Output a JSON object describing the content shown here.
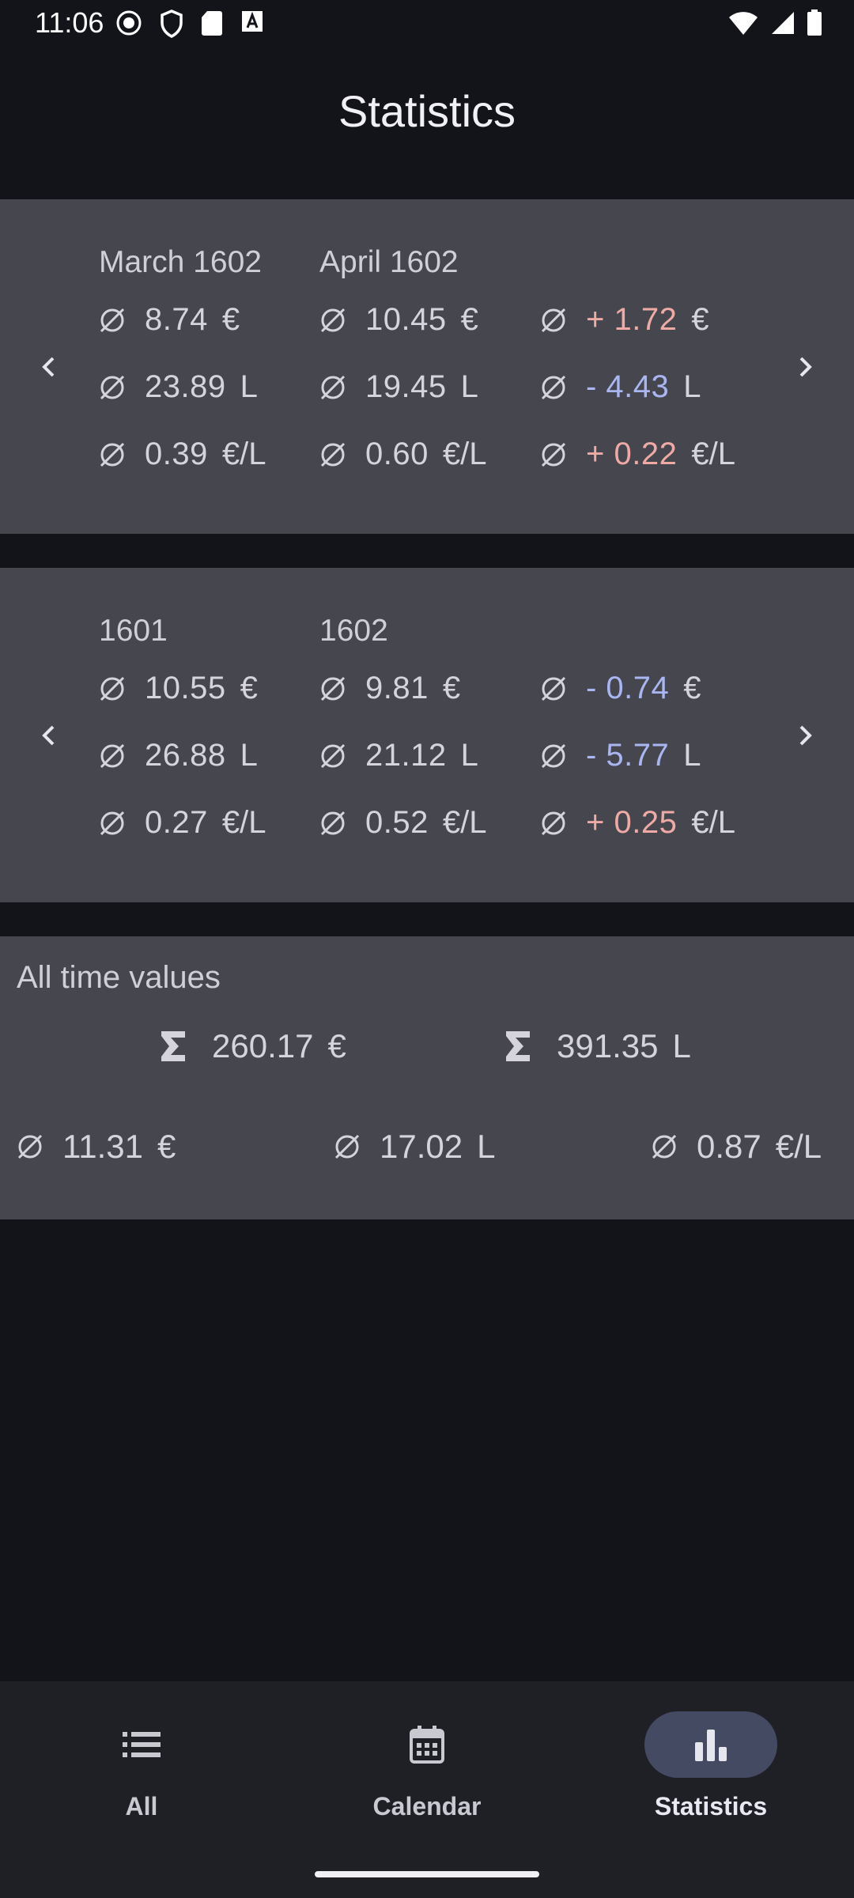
{
  "status_bar": {
    "time": "11:06",
    "icons_left": [
      "record-icon",
      "shield-icon",
      "sdcard-icon",
      "font-a-icon"
    ],
    "icons_right": [
      "wifi-icon",
      "signal-icon",
      "battery-icon"
    ]
  },
  "page": {
    "title": "Statistics"
  },
  "monthly": {
    "left_heading": "March 1602",
    "right_heading": "April 1602",
    "rows": [
      {
        "left": "8.74",
        "right": "10.45",
        "diff": "+ 1.72",
        "unit": "€",
        "diff_sign": "pos"
      },
      {
        "left": "23.89",
        "right": "19.45",
        "diff": "- 4.43",
        "unit": "L",
        "diff_sign": "neg"
      },
      {
        "left": "0.39",
        "right": "0.60",
        "diff": "+ 0.22",
        "unit": "€/L",
        "diff_sign": "pos"
      }
    ]
  },
  "yearly": {
    "left_heading": "1601",
    "right_heading": "1602",
    "rows": [
      {
        "left": "10.55",
        "right": "9.81",
        "diff": "- 0.74",
        "unit": "€",
        "diff_sign": "neg"
      },
      {
        "left": "26.88",
        "right": "21.12",
        "diff": "- 5.77",
        "unit": "L",
        "diff_sign": "neg"
      },
      {
        "left": "0.27",
        "right": "0.52",
        "diff": "+ 0.25",
        "unit": "€/L",
        "diff_sign": "pos"
      }
    ]
  },
  "all_time": {
    "label": "All time values",
    "sum_cost": "260.17",
    "sum_cost_unit": "€",
    "sum_volume": "391.35",
    "sum_volume_unit": "L",
    "avg_cost": "11.31",
    "avg_cost_unit": "€",
    "avg_volume": "17.02",
    "avg_volume_unit": "L",
    "avg_price": "0.87",
    "avg_price_unit": "€/L"
  },
  "bottom_nav": {
    "tabs": [
      {
        "label": "All",
        "icon": "list-icon",
        "active": false
      },
      {
        "label": "Calendar",
        "icon": "calendar-icon",
        "active": false
      },
      {
        "label": "Statistics",
        "icon": "bar-chart-icon",
        "active": true
      }
    ]
  },
  "colors": {
    "background": "#13141a",
    "card": "#46464f",
    "increase": "#f0aaa6",
    "decrease": "#a9b6f2",
    "active_pill": "#454a63"
  }
}
